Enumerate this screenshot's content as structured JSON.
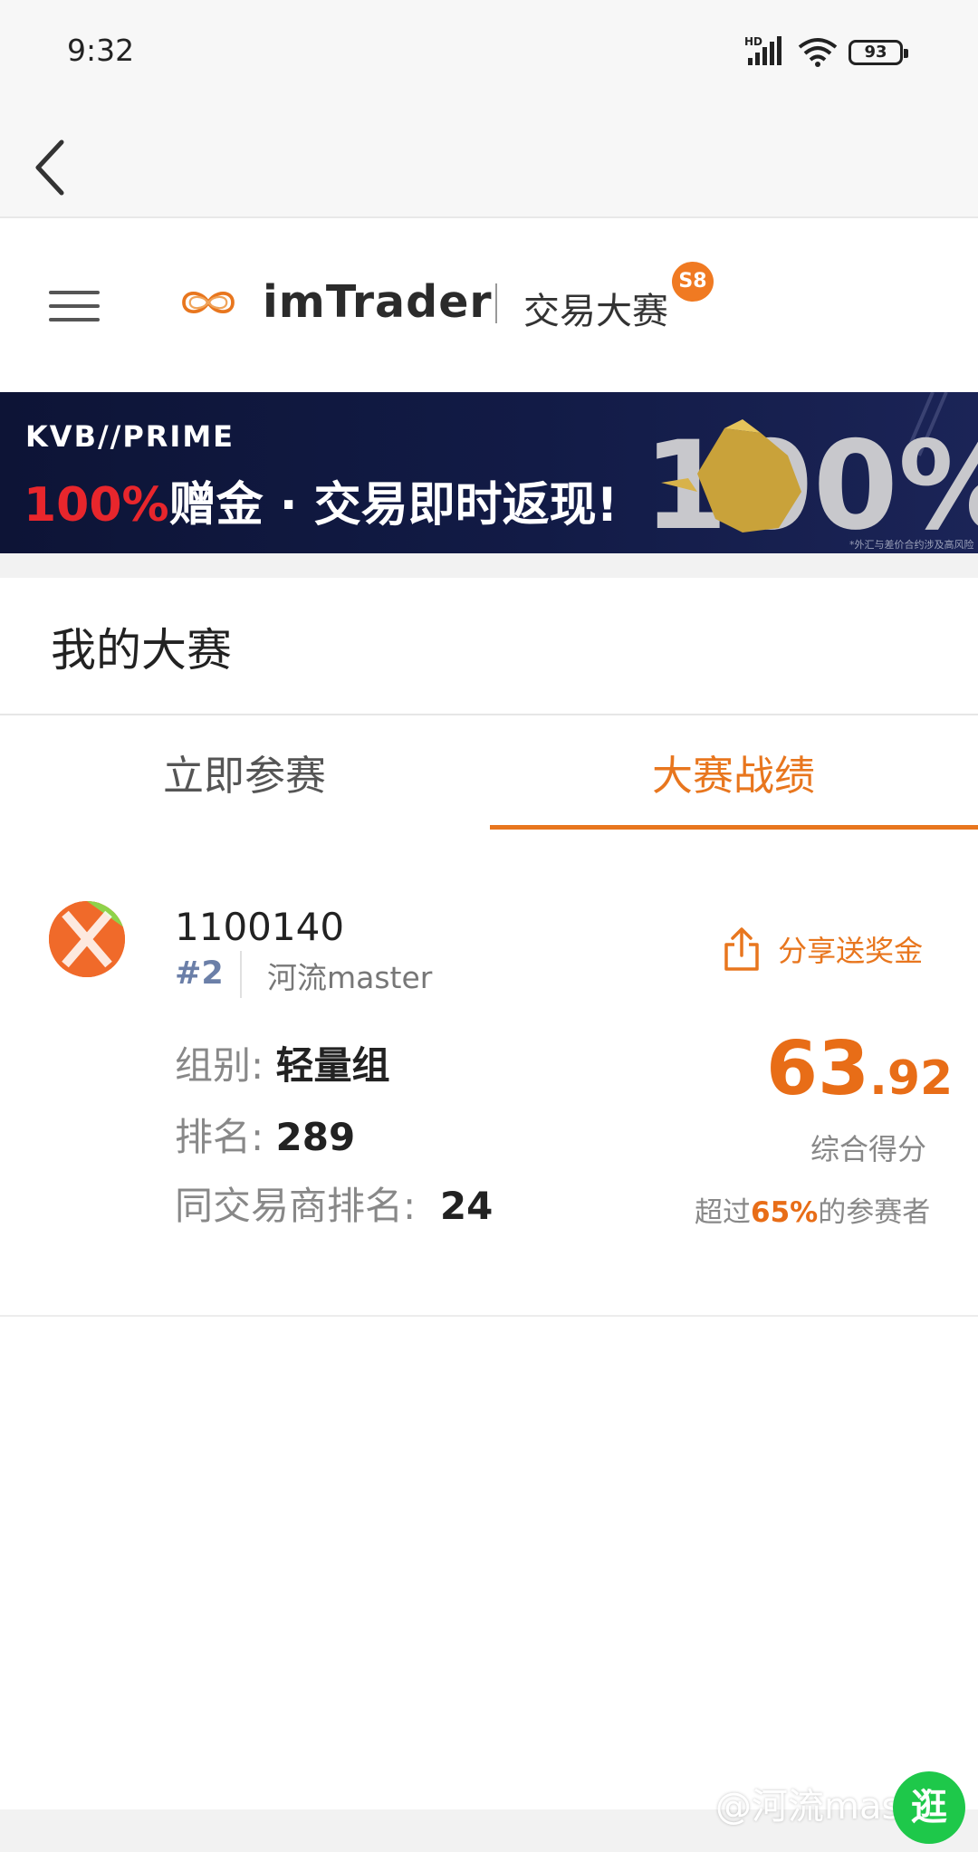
{
  "status_bar": {
    "time": "9:32",
    "network_label": "HD",
    "battery": "93",
    "icons": [
      "signal-icon",
      "wifi-icon",
      "battery-icon"
    ]
  },
  "nav": {
    "back_icon": "chevron-left-icon"
  },
  "header": {
    "menu_icon": "hamburger-menu-icon",
    "logo_icon": "infinity-logo-icon",
    "brand": "imTrader",
    "title": "交易大赛",
    "season_badge": "S8",
    "brand_color": "#e8761e"
  },
  "banner": {
    "brand": "KVB//PRIME",
    "headline_highlight": "100%",
    "headline_rest": "赠金 · 交易即时返现!",
    "art_text": "100%",
    "disclaimer": "*外汇与差价合约涉及高风险"
  },
  "section": {
    "title": "我的大赛"
  },
  "tabs": [
    {
      "label": "立即参赛",
      "active": false
    },
    {
      "label": "大赛战绩",
      "active": true
    }
  ],
  "result": {
    "user_id": "1100140",
    "rank_tag": "#2",
    "nickname": "河流master",
    "share_label": "分享送奖金",
    "share_icon": "share-icon",
    "group_label": "组别: ",
    "group_value": "轻量组",
    "rank_label": "排名: ",
    "rank_value": "289",
    "broker_rank_label": "同交易商排名:  ",
    "broker_rank_value": "24",
    "score_int": "63",
    "score_dec": ".92",
    "score_label": "综合得分",
    "percentile_prefix": "超过",
    "percentile_value": "65%",
    "percentile_suffix": "的参赛者",
    "accent_color": "#e86d17"
  },
  "footer": {
    "watermark": "@河流master",
    "fab_label": "逛"
  }
}
